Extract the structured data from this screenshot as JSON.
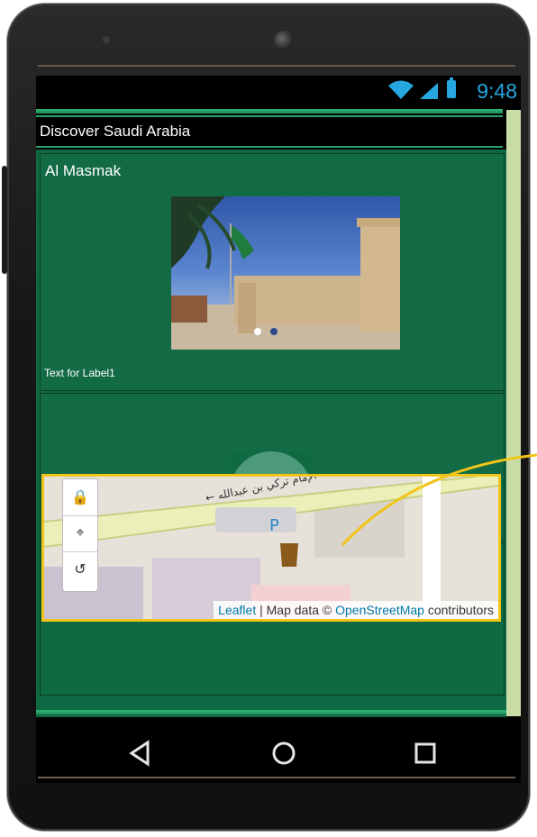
{
  "status_bar": {
    "time": "9:48",
    "icons": [
      "wifi-icon",
      "signal-icon",
      "battery-icon"
    ]
  },
  "app": {
    "title": "Discover Saudi Arabia"
  },
  "card1": {
    "place_name": "Al Masmak",
    "image_description_icon": "fort-photo",
    "caption": "Text for Label1"
  },
  "card2": {
    "button_icon": "map-icon"
  },
  "map": {
    "controls": [
      "lock-icon",
      "locate-icon",
      "reset-icon"
    ],
    "attribution": {
      "leaflet": "Leaflet",
      "separator": " | Map data © ",
      "osm": "OpenStreetMap",
      "contributors": " contributors"
    },
    "street_label": "الإمام تركي بن عبدالله",
    "parking_label": "P"
  },
  "navbar": {
    "icons": [
      "back-icon",
      "home-icon",
      "recents-icon"
    ]
  },
  "colors": {
    "app_green": "#126b45",
    "accent_green": "#2fb77a",
    "status_blue": "#27a7e0",
    "callout_yellow": "#f2c41a"
  }
}
